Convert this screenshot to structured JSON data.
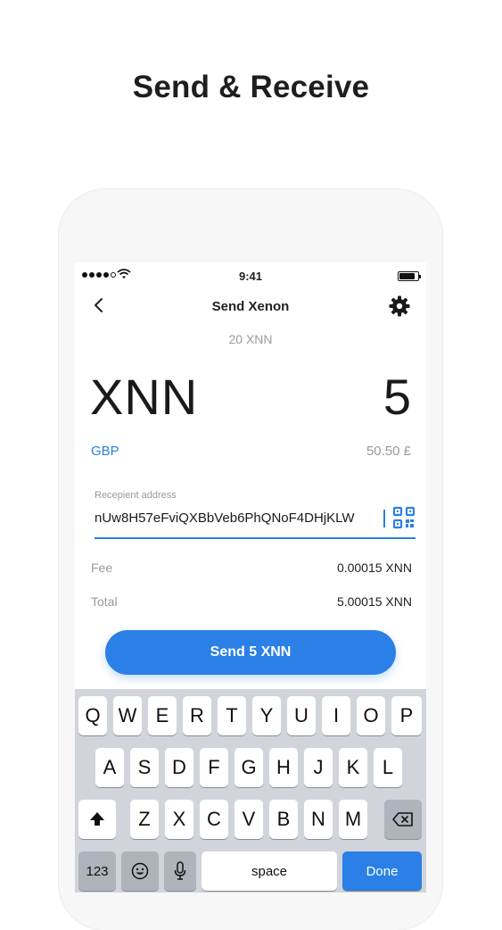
{
  "headline": "Send & Receive",
  "status_bar": {
    "time": "9:41"
  },
  "nav": {
    "title": "Send Xenon"
  },
  "balance": "20 XNN",
  "amount": {
    "currency": "XNN",
    "value": "5"
  },
  "fiat": {
    "code": "GBP",
    "value": "50.50 £"
  },
  "recipient": {
    "label": "Recepient address",
    "value": "nUw8H57eFviQXBbVeb6PhQNoF4DHjKLW"
  },
  "fee": {
    "label": "Fee",
    "value": "0.00015 XNN"
  },
  "total": {
    "label": "Total",
    "value": "5.00015 XNN"
  },
  "send_button": "Send 5 XNN",
  "colors": {
    "accent": "#2a80e6",
    "keyboard_bg": "#d1d5db"
  },
  "keyboard": {
    "row1": [
      "Q",
      "W",
      "E",
      "R",
      "T",
      "Y",
      "U",
      "I",
      "O",
      "P"
    ],
    "row2": [
      "A",
      "S",
      "D",
      "F",
      "G",
      "H",
      "J",
      "K",
      "L"
    ],
    "row3": [
      "Z",
      "X",
      "C",
      "V",
      "B",
      "N",
      "M"
    ],
    "numbers": "123",
    "space": "space",
    "done": "Done",
    "icons": [
      "shift-icon",
      "backspace-icon",
      "emoji-icon",
      "mic-icon"
    ]
  }
}
